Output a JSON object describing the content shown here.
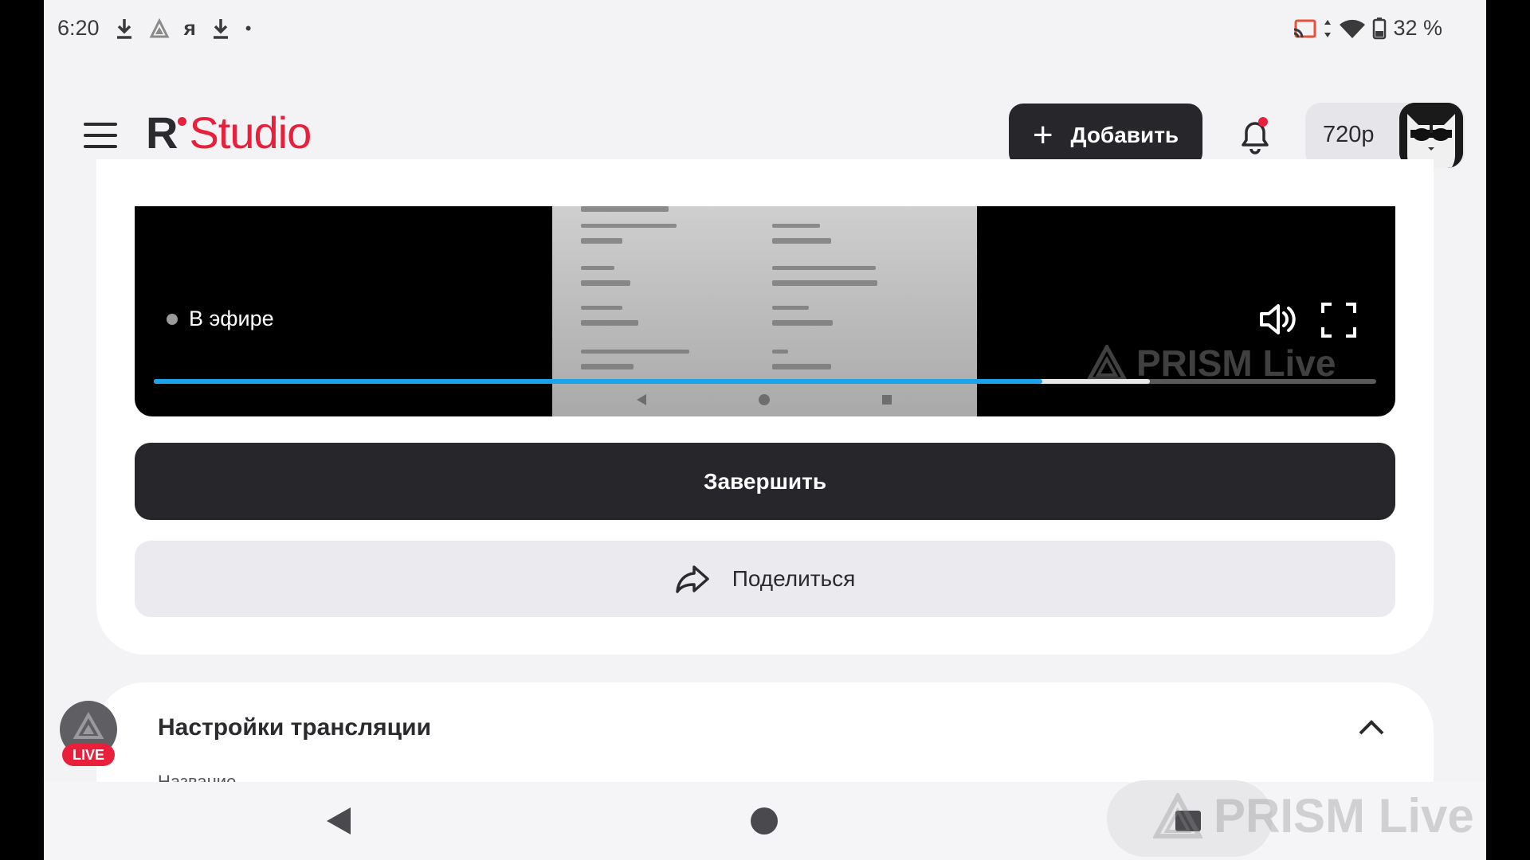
{
  "status_bar": {
    "time": "6:20",
    "battery": "32 %",
    "left_icons": [
      "download-icon",
      "warning-triangle-icon",
      "yandex-icon",
      "download-icon",
      "dot-icon"
    ],
    "right_icons": [
      "cast-icon",
      "data-arrows-icon",
      "wifi-icon",
      "battery-icon"
    ]
  },
  "header": {
    "logo_r": "R",
    "logo_studio": "Studio",
    "add_button": "Добавить",
    "resolution": "720p",
    "brand_red": "#e8203c"
  },
  "player": {
    "status": "В эфире",
    "watermark": "PRISM Live",
    "progress_played": 0.727,
    "progress_buffered": 0.815,
    "progress_color": "#1aa3e8"
  },
  "actions": {
    "finish": "Завершить",
    "share": "Поделиться"
  },
  "settings": {
    "title": "Настройки трансляции",
    "first_field_label": "Название"
  },
  "bubble": {
    "badge": "LIVE"
  },
  "navbar": {
    "watermark": "PRISM Live"
  }
}
